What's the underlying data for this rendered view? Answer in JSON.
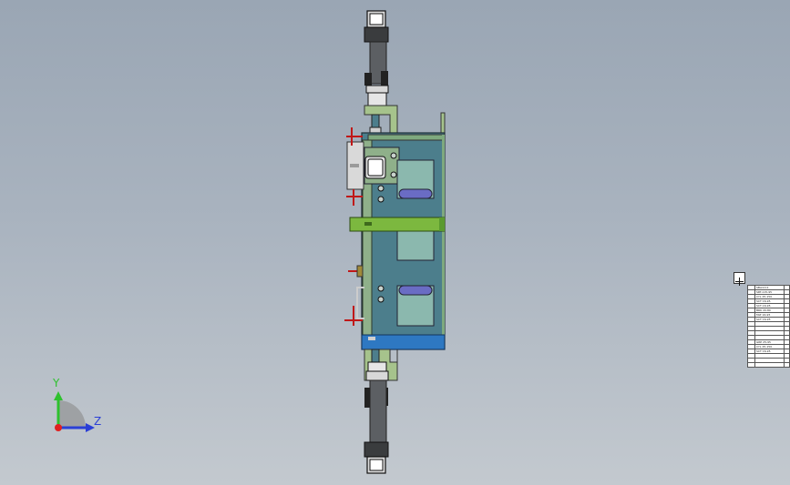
{
  "viewport": {
    "background": "#a7b1bd",
    "axis_triad": {
      "y_label": "Y",
      "z_label": "Z",
      "y_color": "#2ec12e",
      "z_color": "#2b3fd6",
      "x_color": "#e02020"
    }
  },
  "model": {
    "parts": [
      {
        "name": "top-cylinder",
        "color": "#5c5f63"
      },
      {
        "name": "bottom-cylinder",
        "color": "#5c5f63"
      },
      {
        "name": "top-bracket",
        "color": "#a6c38c"
      },
      {
        "name": "bottom-bracket",
        "color": "#a6c38c"
      },
      {
        "name": "main-housing",
        "color": "#4c7e8c"
      },
      {
        "name": "left-plate",
        "color": "#8fb08a"
      },
      {
        "name": "window-upper",
        "color": "#8bb8ae"
      },
      {
        "name": "window-middle",
        "color": "#8bb8ae"
      },
      {
        "name": "window-lower",
        "color": "#8bb8ae"
      },
      {
        "name": "slot-upper",
        "color": "#6a6cc4"
      },
      {
        "name": "slot-lower",
        "color": "#6a6cc4"
      },
      {
        "name": "green-bar",
        "color": "#7cb83f"
      },
      {
        "name": "base-block",
        "color": "#2e78c2"
      },
      {
        "name": "side-block",
        "color": "#d9d9d9"
      },
      {
        "name": "red-pins",
        "color": "#c01818"
      }
    ]
  },
  "bom": {
    "rows": [
      [
        "",
        "SBA1111",
        ""
      ],
      [
        "",
        "SRT-115-95",
        ""
      ],
      [
        "",
        "CYL 25-150",
        ""
      ],
      [
        "",
        "SCT 16-95",
        ""
      ],
      [
        "",
        "SCT 16-95",
        ""
      ],
      [
        "",
        "BRK 20-80",
        ""
      ],
      [
        "",
        "MLT 16-95",
        ""
      ],
      [
        "",
        "SCT 16-95",
        ""
      ],
      [
        "",
        "",
        ""
      ],
      [
        "",
        "",
        ""
      ],
      [
        "",
        "",
        ""
      ],
      [
        "",
        "",
        ""
      ],
      [
        "",
        "GRP 25-95",
        ""
      ],
      [
        "",
        "CYL 25-150",
        ""
      ],
      [
        "",
        "SCT 16-95",
        ""
      ],
      [
        "",
        "",
        ""
      ],
      [
        "",
        "",
        ""
      ],
      [
        "",
        "",
        ""
      ]
    ]
  }
}
